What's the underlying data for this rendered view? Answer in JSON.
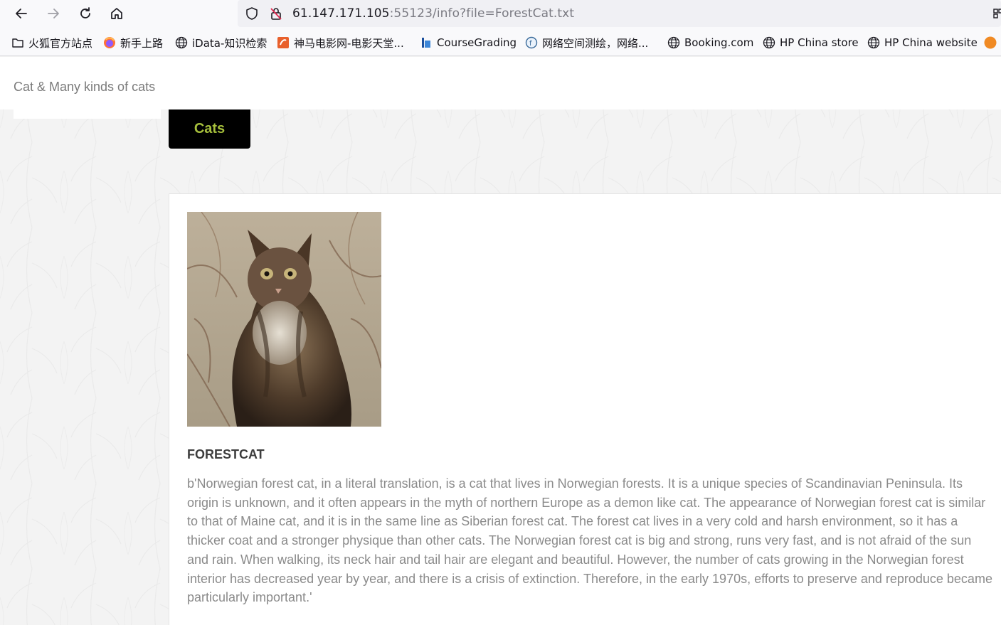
{
  "browser": {
    "url_host": "61.147.171.105",
    "url_rest": ":55123/info?file=ForestCat.txt",
    "bookmarks": [
      {
        "label": "火狐官方站点",
        "icon": "folder-icon"
      },
      {
        "label": "新手上路",
        "icon": "firefox-icon"
      },
      {
        "label": "iData-知识检索",
        "icon": "globe-icon"
      },
      {
        "label": "神马电影网-电影天堂...",
        "icon": "site-icon"
      },
      {
        "label": "CourseGrading",
        "icon": "site-icon"
      },
      {
        "label": "网络空间测绘，网络...",
        "icon": "site-icon"
      },
      {
        "label": "Booking.com",
        "icon": "globe-icon"
      },
      {
        "label": "HP China store",
        "icon": "globe-icon"
      },
      {
        "label": "HP China website",
        "icon": "globe-icon"
      }
    ]
  },
  "site": {
    "title": "Cat & Many kinds of cats",
    "nav_button": "Cats"
  },
  "article": {
    "heading": "FORESTCAT",
    "body": "b'Norwegian forest cat, in a literal translation, is a cat that lives in Norwegian forests. It is a unique species of Scandinavian Peninsula. Its origin is unknown, and it often appears in the myth of northern Europe as a demon like cat. The appearance of Norwegian forest cat is similar to that of Maine cat, and it is in the same line as Siberian forest cat. The forest cat lives in a very cold and harsh environment, so it has a thicker coat and a stronger physique than other cats. The Norwegian forest cat is big and strong, runs very fast, and is not afraid of the sun and rain. When walking, its neck hair and tail hair are elegant and beautiful. However, the number of cats growing in the Norwegian forest interior has decreased year by year, and there is a crisis of extinction. Therefore, in the early 1970s, efforts to preserve and reproduce became particularly important.'"
  },
  "colors": {
    "nav_button_bg": "#000000",
    "nav_button_text": "#a6bf3c",
    "body_text": "#8a8a8a",
    "heading_text": "#3d3d3d"
  }
}
